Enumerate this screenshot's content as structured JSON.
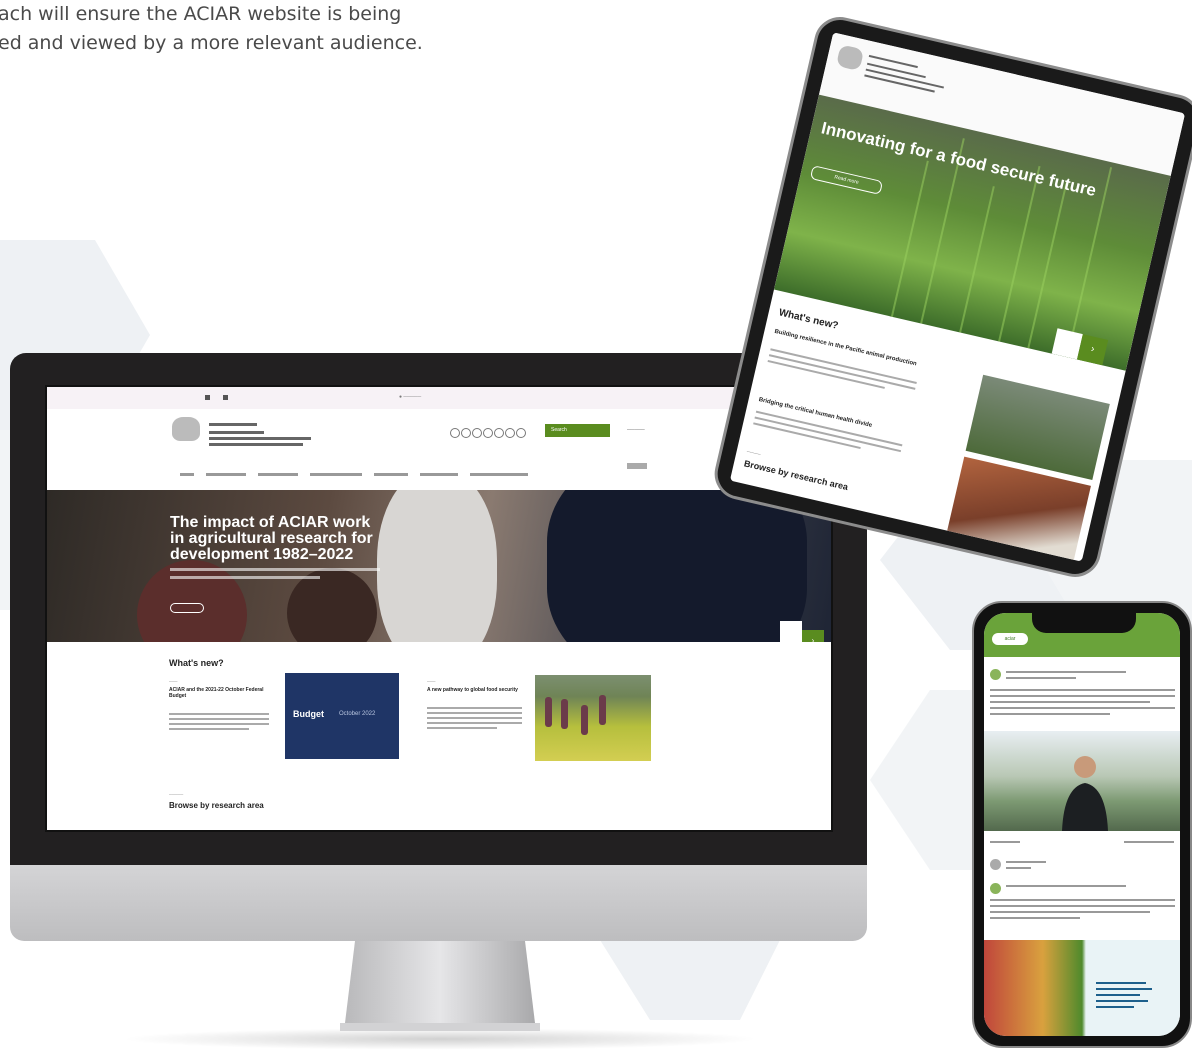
{
  "intro": {
    "line1": "ach will ensure the ACIAR website is being",
    "line2": "ed and viewed by a more relevant audience."
  },
  "desktop_site": {
    "header_button": "Search",
    "hero_title": "The impact of ACIAR work in agricultural research for development 1982–2022",
    "whats_new_title": "What's new?",
    "card1_title": "ACIAR and the 2021-22 October Federal Budget",
    "budget_label": "Budget",
    "budget_sublabel": "October 2022",
    "card2_title": "A new pathway to global food security",
    "browse_label": "Browse by research area"
  },
  "tablet_site": {
    "hero_title": "Innovating for a food secure future",
    "hero_button": "Read more",
    "whats_new_title": "What's new?",
    "card1_title": "Building resilience in the Pacific animal production",
    "card2_title": "Bridging the critical human health divide",
    "browse_label": "Browse by research area"
  },
  "phone_site": {
    "brand": "aciar"
  },
  "colors": {
    "brand_green": "#5a8c1f",
    "hex_pattern": "#eef1f4",
    "device_dark": "#222021"
  }
}
